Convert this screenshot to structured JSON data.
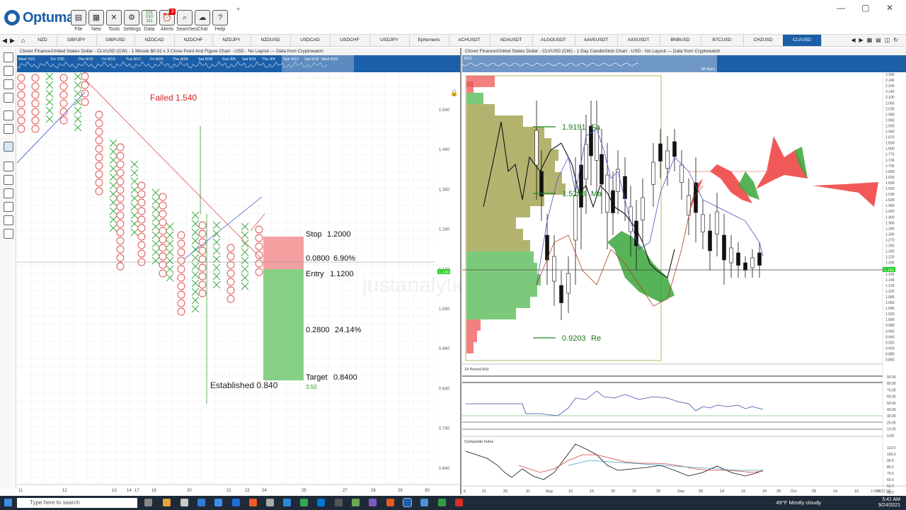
{
  "app": {
    "name": "Optuma"
  },
  "toolbar": {
    "buttons": [
      {
        "label": "File",
        "icon": "folder-icon"
      },
      {
        "label": "New",
        "icon": "new-document-icon"
      },
      {
        "label": "Tools",
        "icon": "tools-icon"
      },
      {
        "label": "Settings",
        "icon": "gear-icon"
      },
      {
        "label": "Data",
        "icon": "data-icon"
      },
      {
        "label": "Alerts",
        "icon": "alarm-clock-icon",
        "badge": "3"
      },
      {
        "label": "Searches",
        "icon": "search-icon"
      },
      {
        "label": "Chat",
        "icon": "chat-icon"
      },
      {
        "label": "Help",
        "icon": "help-icon"
      }
    ],
    "data_icon_glyph": "101\n010\n111"
  },
  "tabs": [
    "NZD",
    "GBPJPY",
    "GBPUSD",
    "NZDCAD",
    "NZDCHF",
    "NZDJPY",
    "NZDUSD",
    "USDCAD",
    "USDCHF",
    "USDJPY",
    "Ephemeris",
    "ACHUSDT",
    "ADAUSDT",
    "ALGOUSDT",
    "AAVEUSDT",
    "AXSUSDT",
    "BNBUSD",
    "BTCUSD",
    "CHZUSD",
    "CLVUSD"
  ],
  "active_tab": "CLVUSD",
  "left_chart": {
    "title": "Clover Finance/United States Dollar - CLVUSD (CW) - 1 Minute $0.02 x 3 Close Point And Figure Chart - USD - No Layout — Data from Cryptowatch",
    "nav_dates": [
      "Wed 7/21",
      "Fri 7/30",
      "Thu 8/12",
      "Fri 8/13",
      "Tue 8/17",
      "Fri 8/20",
      "Thu 8/26",
      "Sat 8/28",
      "Sun 9/5",
      "Sat 9/11",
      "Thu 9/9",
      "Sun 9/12",
      "Sat 9/18",
      "Wed 9/22"
    ],
    "failed_label": "Failed 1.540",
    "established_label": "Established 0.840",
    "established_sub": "3.50",
    "stop_label": "Stop",
    "stop_value": "1.2000",
    "risk_value": "0.0800",
    "risk_pct": "6.90%",
    "entry_label": "Entry",
    "entry_value": "1.1200",
    "reward_value": "0.2800",
    "reward_pct": "24.14%",
    "target_label": "Target",
    "target_value": "0.8400",
    "price_axis": [
      "1.540",
      "1.440",
      "1.340",
      "1.240",
      "1.140",
      "1.040",
      "0.940",
      "0.840",
      "0.740",
      "0.640"
    ],
    "current_price": "1.140",
    "x_axis": [
      "11",
      "12",
      "13",
      "14",
      "17",
      "18",
      "20",
      "21",
      "22",
      "24",
      "25",
      "27",
      "28",
      "29",
      "30"
    ],
    "watermark": "justanalytic"
  },
  "right_chart": {
    "title": "Clover Finance/United States Dollar - CLVUSD (CW) - 1 Day CandleStick Chart - USD - No Layout — Data from Cryptowatch",
    "nav_year": "2021",
    "nav_bars": "98 Bars",
    "level_high": "1.9191",
    "level_high_suffix": "Fa",
    "level_mid": "1.5208",
    "level_mid_suffix": "Ma",
    "level_low": "0.9203",
    "level_low_suffix": "Re",
    "price_axis": [
      "2.300",
      "2.240",
      "2.200",
      "2.140",
      "2.100",
      "2.060",
      "2.030",
      "1.990",
      "1.960",
      "1.930",
      "1.900",
      "1.870",
      "1.830",
      "1.800",
      "1.770",
      "1.730",
      "1.700",
      "1.660",
      "1.630",
      "1.600",
      "1.560",
      "1.530",
      "1.500",
      "1.450",
      "1.420",
      "1.400",
      "1.360",
      "1.340",
      "1.300",
      "1.270",
      "1.260",
      "1.240",
      "1.220",
      "1.200",
      "1.180",
      "1.160",
      "1.140",
      "1.120",
      "1.100",
      "1.080",
      "1.060",
      "1.040",
      "1.020",
      "1.000",
      "0.980",
      "0.960",
      "0.940",
      "0.920",
      "0.900",
      "0.880",
      "0.850"
    ],
    "current_price": "1.136",
    "rsi_title": "14 Period RSI",
    "rsi_axis": [
      "90.00",
      "80.00",
      "70.00",
      "60.00",
      "50.00",
      "40.00",
      "30.00",
      "20.00",
      "10.00",
      "0.00"
    ],
    "ci_title": "Composite Index",
    "ci_axis": [
      "110.0",
      "100.0",
      "90.0",
      "80.0",
      "70.0",
      "60.0",
      "50.0",
      "40.0",
      "30.0",
      "20.0",
      "10.0"
    ],
    "x_axis": [
      "6",
      "21",
      "26",
      "31",
      "Aug",
      "10",
      "15",
      "20",
      "25",
      "30",
      "Sep",
      "09",
      "14",
      "19",
      "24",
      "29",
      "Oct",
      "09",
      "14",
      "19",
      "24"
    ],
    "bottom_right": "2.8 0.021766"
  },
  "taskbar": {
    "search_placeholder": "Type here to search",
    "weather": "49°F  Mostly cloudy",
    "time": "5:41 AM",
    "date": "9/24/2021"
  },
  "colors": {
    "brand": "#1b5fa8",
    "stop_zone": "#f4a0a0",
    "target_zone": "#7fcf7f",
    "level_line": "#1a8a1a",
    "failed_text": "#d42020",
    "cloud_green": "#3aa63a",
    "cloud_red": "#ee3c3c"
  }
}
